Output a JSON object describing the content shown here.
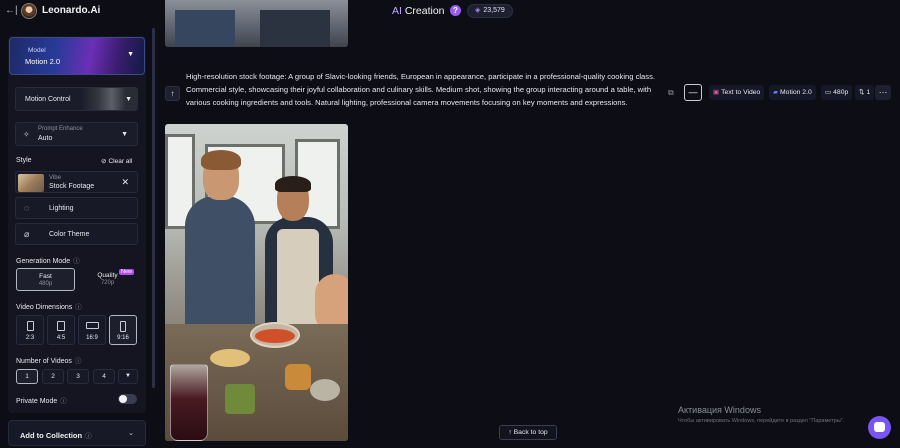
{
  "header": {
    "back_glyph": "←|",
    "brand": "Leonardo.Ai",
    "title_accent": "AI",
    "title_rest": " Creation",
    "help_glyph": "?",
    "credits": "23,579"
  },
  "sidebar": {
    "model": {
      "label": "Model",
      "value": "Motion 2.0"
    },
    "motion_control": {
      "label": "Motion Control"
    },
    "prompt_enhance": {
      "label": "Prompt Enhance",
      "value": "Auto"
    },
    "style": {
      "heading": "Style",
      "clear_all": "Clear all",
      "vibe": {
        "label": "Vibe",
        "value": "Stock Footage"
      },
      "lighting": "Lighting",
      "color_theme": "Color Theme"
    },
    "generation_mode": {
      "heading": "Generation Mode",
      "fast": {
        "label": "Fast",
        "res": "480p"
      },
      "quality": {
        "label": "Quality",
        "res": "720p",
        "badge": "New"
      }
    },
    "video_dimensions": {
      "heading": "Video Dimensions",
      "options": [
        "2:3",
        "4:5",
        "16:9",
        "9:16"
      ],
      "selected": "9:16"
    },
    "number_of_videos": {
      "heading": "Number of Videos",
      "options": [
        "1",
        "2",
        "3",
        "4"
      ],
      "selected": "1"
    },
    "private_mode": {
      "heading": "Private Mode",
      "enabled": false
    },
    "add_to_collection": "Add to Collection"
  },
  "generation": {
    "prompt": "High-resolution stock footage: A group of Slavic-looking friends, European in appearance, participate in a professional-quality cooking class. Commercial style, showcasing their joyful collaboration and culinary skills. Medium shot, showing the group interacting around a table, with various cooking ingredients and tools. Natural lighting, professional camera movements focusing on key moments and expressions.",
    "chips": {
      "type": "Text to Video",
      "model": "Motion 2.0",
      "resolution": "480p",
      "count": "1"
    }
  },
  "footer": {
    "back_to_top": "Back to top",
    "watermark_title": "Активация Windows",
    "watermark_sub": "Чтобы активировать Windows, перейдите в раздел \"Параметры\"."
  },
  "colors": {
    "accent": "#9a5cf3",
    "background": "#0d0e15",
    "panel": "#141521"
  }
}
